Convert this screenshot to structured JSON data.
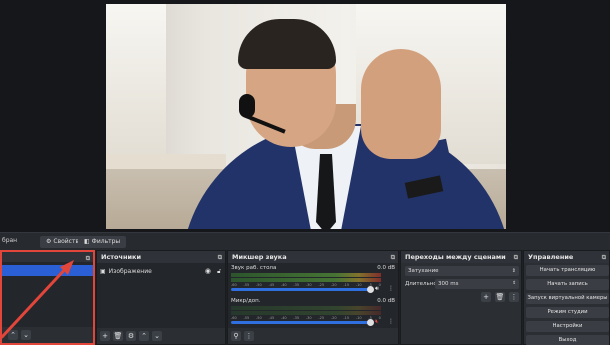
{
  "toolbar": {
    "scene_label": "бран",
    "properties_label": "Свойства",
    "filters_label": "Фильтры"
  },
  "scenes_dock": {
    "title": "",
    "selected_index": 0
  },
  "sources_dock": {
    "title": "Источники",
    "items": [
      {
        "label": "Изображение",
        "icon": "image-icon",
        "visible": true,
        "locked": false
      }
    ]
  },
  "mixer_dock": {
    "title": "Микшер звука",
    "channels": [
      {
        "name": "Звук раб. стола",
        "db": "0.0 dB",
        "volume_percent": 100,
        "muted": false
      },
      {
        "name": "Микр/доп.",
        "db": "0.0 dB",
        "volume_percent": 100,
        "muted": true
      }
    ],
    "scale_ticks": [
      "-60",
      "-55",
      "-50",
      "-45",
      "-40",
      "-35",
      "-30",
      "-25",
      "-20",
      "-15",
      "-10",
      "-5",
      "0"
    ]
  },
  "transitions_dock": {
    "title": "Переходы между сценами",
    "transition_value": "Затухание",
    "duration_label": "Длительность",
    "duration_value": "300 ms"
  },
  "controls_dock": {
    "title": "Управление",
    "buttons": [
      "Начать трансляцию",
      "Начать запись",
      "Запуск виртуальной камеры",
      "Режим студии",
      "Настройки",
      "Выход"
    ]
  },
  "colors": {
    "accent_blue": "#2a5fd6",
    "annotation_red": "#e2453a",
    "dock_bg": "#2b2e33"
  }
}
